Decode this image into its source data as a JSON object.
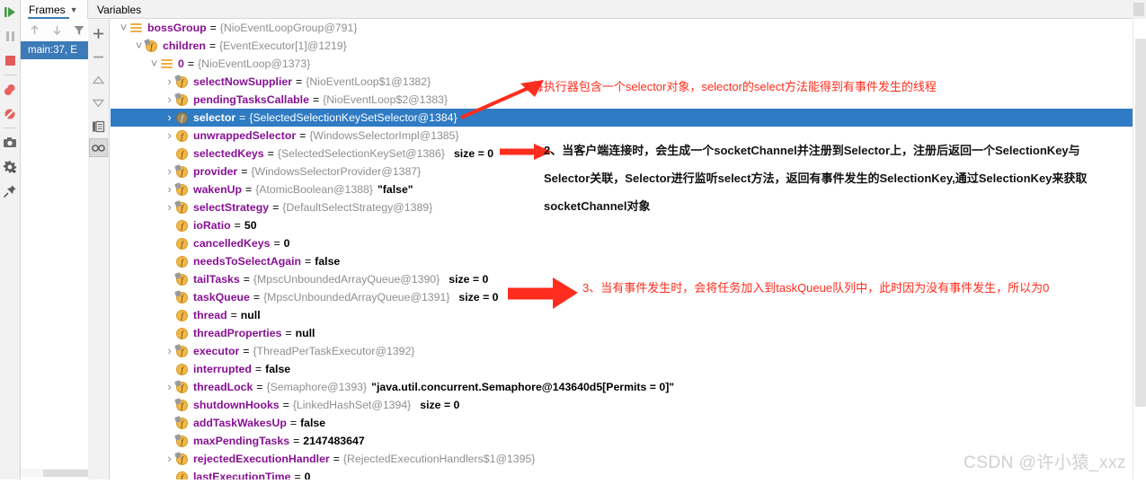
{
  "window": {
    "accent_color": "#2f7bc4",
    "annotation_red": "#ff2d1e",
    "watermark": "CSDN @许小猿_xxz"
  },
  "debug_toolbar": {
    "buttons": [
      {
        "name": "resume-program-icon",
        "glyph": "resume"
      },
      {
        "name": "pause-program-icon",
        "glyph": "pause"
      },
      {
        "name": "stop-program-icon",
        "glyph": "stop"
      },
      {
        "name": "view-breakpoints-icon",
        "glyph": "breakpoints"
      },
      {
        "name": "mute-breakpoints-icon",
        "glyph": "mute"
      },
      {
        "name": "get-thread-dump-icon",
        "glyph": "camera"
      },
      {
        "name": "settings-icon",
        "glyph": "gear"
      },
      {
        "name": "pin-tab-icon",
        "glyph": "pin"
      }
    ]
  },
  "tabs": [
    {
      "label": "Frames",
      "active": true,
      "has_dropdown": true
    },
    {
      "label": "Variables",
      "active": false,
      "has_dropdown": false
    }
  ],
  "frames_panel": {
    "toolbar": [
      {
        "name": "stack-up-icon",
        "glyph": "arrow-up"
      },
      {
        "name": "stack-down-icon",
        "glyph": "arrow-down"
      },
      {
        "name": "filter-frames-icon",
        "glyph": "funnel"
      }
    ],
    "frames": [
      {
        "label": "main:37, E",
        "selected": true
      }
    ]
  },
  "mini_toolbar": [
    {
      "name": "add-watch-icon",
      "glyph": "plus"
    },
    {
      "name": "remove-watch-icon",
      "glyph": "minus"
    },
    {
      "name": "move-up-icon",
      "glyph": "tri-up"
    },
    {
      "name": "move-down-icon",
      "glyph": "tri-down"
    },
    {
      "name": "copy-value-icon",
      "glyph": "copy"
    },
    {
      "name": "inspect-icon",
      "glyph": "glasses",
      "boxed": true
    }
  ],
  "variables": [
    {
      "indent": 0,
      "toggle": "expanded",
      "icon": "list",
      "name": "bossGroup",
      "value": "{NioEventLoopGroup@791}",
      "size": "",
      "selected": false
    },
    {
      "indent": 1,
      "toggle": "expanded",
      "icon": "field-final",
      "name": "children",
      "value": "{EventExecutor[1]@1219}",
      "size": "",
      "selected": false
    },
    {
      "indent": 2,
      "toggle": "expanded",
      "icon": "list",
      "name": "0",
      "value": "{NioEventLoop@1373}",
      "size": "",
      "selected": false
    },
    {
      "indent": 3,
      "toggle": "collapsed",
      "icon": "field-final",
      "name": "selectNowSupplier",
      "value": "{NioEventLoop$1@1382}",
      "size": "",
      "selected": false
    },
    {
      "indent": 3,
      "toggle": "collapsed",
      "icon": "field-final",
      "name": "pendingTasksCallable",
      "value": "{NioEventLoop$2@1383}",
      "size": "",
      "selected": false
    },
    {
      "indent": 3,
      "toggle": "collapsed",
      "icon": "field",
      "name": "selector",
      "value": "{SelectedSelectionKeySetSelector@1384}",
      "size": "",
      "selected": true
    },
    {
      "indent": 3,
      "toggle": "collapsed",
      "icon": "field",
      "name": "unwrappedSelector",
      "value": "{WindowsSelectorImpl@1385}",
      "size": "",
      "selected": false
    },
    {
      "indent": 3,
      "toggle": "none",
      "icon": "field",
      "name": "selectedKeys",
      "value": "{SelectedSelectionKeySet@1386}",
      "size": "size = 0",
      "selected": false
    },
    {
      "indent": 3,
      "toggle": "collapsed",
      "icon": "field-final",
      "name": "provider",
      "value": "{WindowsSelectorProvider@1387}",
      "size": "",
      "selected": false
    },
    {
      "indent": 3,
      "toggle": "collapsed",
      "icon": "field-final",
      "name": "wakenUp",
      "value": "{AtomicBoolean@1388}",
      "size": "",
      "strval": "\"false\"",
      "selected": false
    },
    {
      "indent": 3,
      "toggle": "collapsed",
      "icon": "field-final",
      "name": "selectStrategy",
      "value": "{DefaultSelectStrategy@1389}",
      "size": "",
      "selected": false
    },
    {
      "indent": 3,
      "toggle": "none",
      "icon": "field",
      "name": "ioRatio",
      "value": "50",
      "plain": true,
      "size": "",
      "selected": false
    },
    {
      "indent": 3,
      "toggle": "none",
      "icon": "field",
      "name": "cancelledKeys",
      "value": "0",
      "plain": true,
      "size": "",
      "selected": false
    },
    {
      "indent": 3,
      "toggle": "none",
      "icon": "field",
      "name": "needsToSelectAgain",
      "value": "false",
      "plain": true,
      "size": "",
      "selected": false
    },
    {
      "indent": 3,
      "toggle": "none",
      "icon": "field-final",
      "name": "tailTasks",
      "value": "{MpscUnboundedArrayQueue@1390}",
      "size": "size = 0",
      "selected": false
    },
    {
      "indent": 3,
      "toggle": "none",
      "icon": "field-final",
      "name": "taskQueue",
      "value": "{MpscUnboundedArrayQueue@1391}",
      "size": "size = 0",
      "selected": false
    },
    {
      "indent": 3,
      "toggle": "none",
      "icon": "field",
      "name": "thread",
      "value": "null",
      "plain": true,
      "size": "",
      "selected": false
    },
    {
      "indent": 3,
      "toggle": "none",
      "icon": "field",
      "name": "threadProperties",
      "value": "null",
      "plain": true,
      "size": "",
      "selected": false
    },
    {
      "indent": 3,
      "toggle": "collapsed",
      "icon": "field-final",
      "name": "executor",
      "value": "{ThreadPerTaskExecutor@1392}",
      "size": "",
      "selected": false
    },
    {
      "indent": 3,
      "toggle": "none",
      "icon": "field",
      "name": "interrupted",
      "value": "false",
      "plain": true,
      "size": "",
      "selected": false
    },
    {
      "indent": 3,
      "toggle": "collapsed",
      "icon": "field-final",
      "name": "threadLock",
      "value": "{Semaphore@1393}",
      "strval": "\"java.util.concurrent.Semaphore@143640d5[Permits = 0]\"",
      "size": "",
      "selected": false
    },
    {
      "indent": 3,
      "toggle": "none",
      "icon": "field-final",
      "name": "shutdownHooks",
      "value": "{LinkedHashSet@1394}",
      "size": "size = 0",
      "selected": false
    },
    {
      "indent": 3,
      "toggle": "none",
      "icon": "field-final",
      "name": "addTaskWakesUp",
      "value": "false",
      "plain": true,
      "size": "",
      "selected": false
    },
    {
      "indent": 3,
      "toggle": "none",
      "icon": "field-final",
      "name": "maxPendingTasks",
      "value": "2147483647",
      "plain": true,
      "size": "",
      "selected": false
    },
    {
      "indent": 3,
      "toggle": "collapsed",
      "icon": "field-final",
      "name": "rejectedExecutionHandler",
      "value": "{RejectedExecutionHandlers$1@1395}",
      "size": "",
      "selected": false
    },
    {
      "indent": 3,
      "toggle": "none",
      "icon": "field",
      "name": "lastExecutionTime",
      "value": "0",
      "plain": true,
      "size": "",
      "selected": false
    }
  ],
  "annotations": [
    {
      "id": "anno-1",
      "color": "red",
      "lines": [
        "1.每执行器包含一个selector对象，selector的select方法能得到有事件发生的线程"
      ]
    },
    {
      "id": "anno-2",
      "color": "black",
      "lines": [
        "2、当客户端连接时，会生成一个socketChannel并注册到Selector上，注册后返回一个SelectionKey与",
        "Selector关联，Selector进行监听select方法，返回有事件发生的SelectionKey,通过SelectionKey来获取",
        "socketChannel对象"
      ]
    },
    {
      "id": "anno-3",
      "color": "red",
      "lines": [
        "3、当有事件发生时，会将任务加入到taskQueue队列中，此时因为没有事件发生，所以为0"
      ]
    }
  ]
}
